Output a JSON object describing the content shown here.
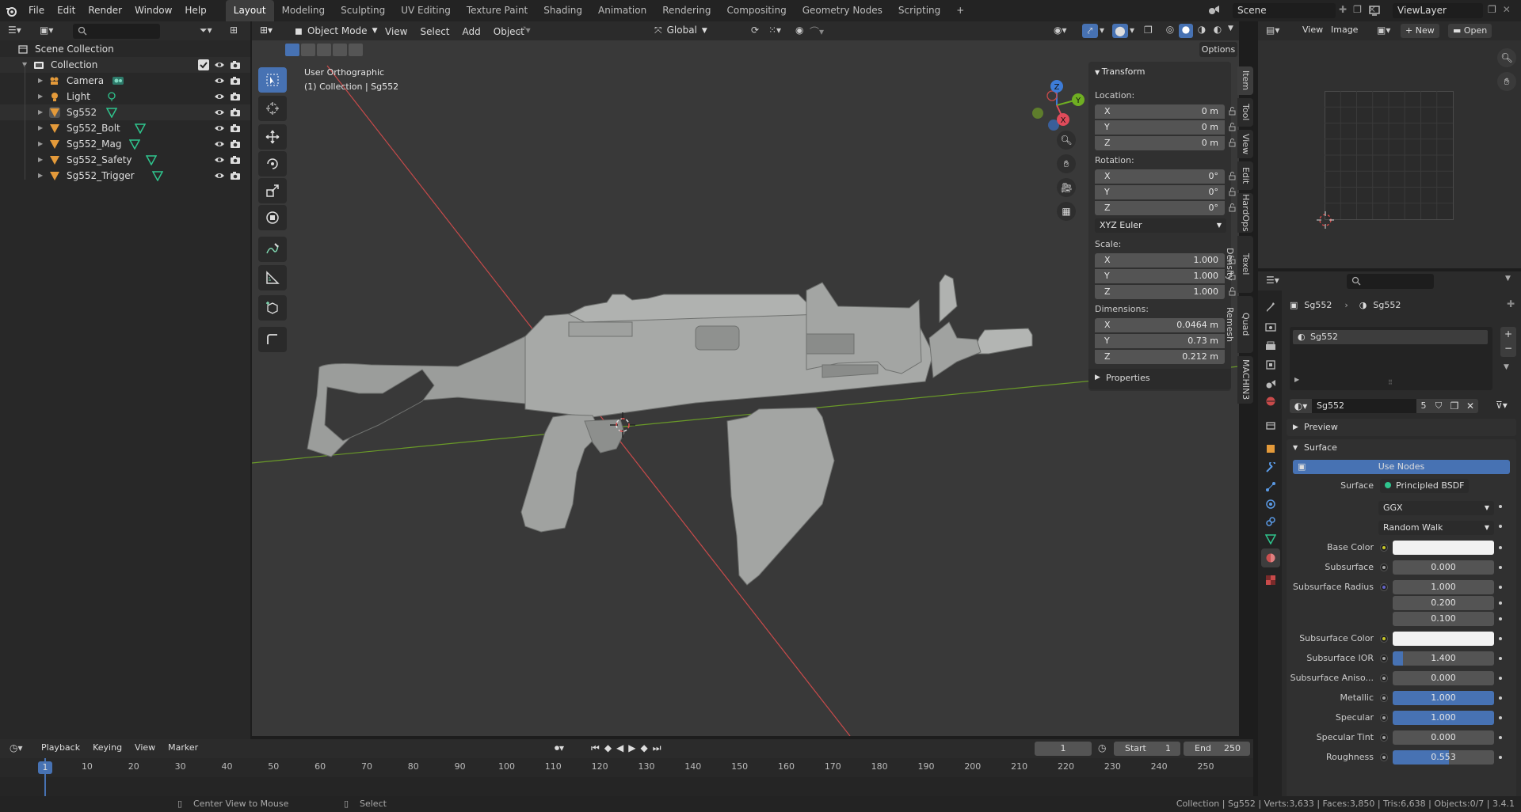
{
  "topbar": {
    "menus": [
      "File",
      "Edit",
      "Render",
      "Window",
      "Help"
    ],
    "workspaces": [
      "Layout",
      "Modeling",
      "Sculpting",
      "UV Editing",
      "Texture Paint",
      "Shading",
      "Animation",
      "Rendering",
      "Compositing",
      "Geometry Nodes",
      "Scripting"
    ],
    "add_workspace": "+",
    "scene": "Scene",
    "view_layer": "ViewLayer"
  },
  "outliner": {
    "root": "Scene Collection",
    "collection": "Collection",
    "items": [
      "Camera",
      "Light",
      "Sg552",
      "Sg552_Bolt",
      "Sg552_Mag",
      "Sg552_Safety",
      "Sg552_Trigger"
    ]
  },
  "viewport": {
    "mode": "Object Mode",
    "menus": [
      "View",
      "Select",
      "Add",
      "Object"
    ],
    "orientation": "Global",
    "options": "Options",
    "view_name": "User Orthographic",
    "context": "(1) Collection | Sg552",
    "gizmo": {
      "x": "X",
      "y": "Y",
      "z": "Z"
    }
  },
  "npanel": {
    "title": "Transform",
    "location_label": "Location:",
    "location": [
      {
        "ax": "X",
        "v": "0 m"
      },
      {
        "ax": "Y",
        "v": "0 m"
      },
      {
        "ax": "Z",
        "v": "0 m"
      }
    ],
    "rotation_label": "Rotation:",
    "rotation": [
      {
        "ax": "X",
        "v": "0°"
      },
      {
        "ax": "Y",
        "v": "0°"
      },
      {
        "ax": "Z",
        "v": "0°"
      }
    ],
    "rotation_mode": "XYZ Euler",
    "scale_label": "Scale:",
    "scale": [
      {
        "ax": "X",
        "v": "1.000"
      },
      {
        "ax": "Y",
        "v": "1.000"
      },
      {
        "ax": "Z",
        "v": "1.000"
      }
    ],
    "dimensions_label": "Dimensions:",
    "dimensions": [
      {
        "ax": "X",
        "v": "0.0464 m"
      },
      {
        "ax": "Y",
        "v": "0.73 m"
      },
      {
        "ax": "Z",
        "v": "0.212 m"
      }
    ],
    "properties": "Properties",
    "tabs": [
      "Item",
      "Tool",
      "View",
      "Edit",
      "HardOps",
      "Texel Density",
      "Quad Remesh",
      "MACHIN3"
    ]
  },
  "image_editor": {
    "menus": [
      "View",
      "Image"
    ],
    "new": "New",
    "open": "Open"
  },
  "properties": {
    "breadcrumb": [
      "Sg552",
      "Sg552"
    ],
    "slot": "Sg552",
    "material": "Sg552",
    "users": "5",
    "preview": "Preview",
    "surface_panel": "Surface",
    "use_nodes": "Use Nodes",
    "surface_label": "Surface",
    "surface_value": "Principled BSDF",
    "distribution": "GGX",
    "subsurface_method": "Random Walk",
    "rows": [
      {
        "label": "Base Color",
        "value": "",
        "kind": "white"
      },
      {
        "label": "Subsurface",
        "value": "0.000",
        "kind": "num"
      },
      {
        "label": "Subsurface Radius",
        "value": "1.000",
        "kind": "num"
      },
      {
        "label": "",
        "value": "0.200",
        "kind": "num"
      },
      {
        "label": "",
        "value": "0.100",
        "kind": "num"
      },
      {
        "label": "Subsurface Color",
        "value": "",
        "kind": "white"
      },
      {
        "label": "Subsurface IOR",
        "value": "1.400",
        "kind": "part"
      },
      {
        "label": "Subsurface Aniso...",
        "value": "0.000",
        "kind": "num"
      },
      {
        "label": "Metallic",
        "value": "1.000",
        "kind": "blue"
      },
      {
        "label": "Specular",
        "value": "1.000",
        "kind": "blue"
      },
      {
        "label": "Specular Tint",
        "value": "0.000",
        "kind": "num"
      },
      {
        "label": "Roughness",
        "value": "0.553",
        "kind": "rough"
      }
    ]
  },
  "timeline": {
    "menus": [
      "Playback",
      "Keying",
      "View",
      "Marker"
    ],
    "current_frame": "1",
    "start_label": "Start",
    "start": "1",
    "end_label": "End",
    "end": "250",
    "ticks": [
      "1",
      "10",
      "20",
      "30",
      "40",
      "50",
      "60",
      "70",
      "80",
      "90",
      "100",
      "110",
      "120",
      "130",
      "140",
      "150",
      "160",
      "170",
      "180",
      "190",
      "200",
      "210",
      "220",
      "230",
      "240",
      "250"
    ]
  },
  "status": {
    "hint1": "Center View to Mouse",
    "hint2": "Select",
    "stats": "Collection | Sg552 | Verts:3,633 | Faces:3,850 | Tris:6,638 | Objects:0/7 | 3.4.1"
  },
  "colors": {
    "accent": "#4772b3",
    "header": "#232323",
    "panel": "#303030",
    "viewport": "#393939"
  }
}
